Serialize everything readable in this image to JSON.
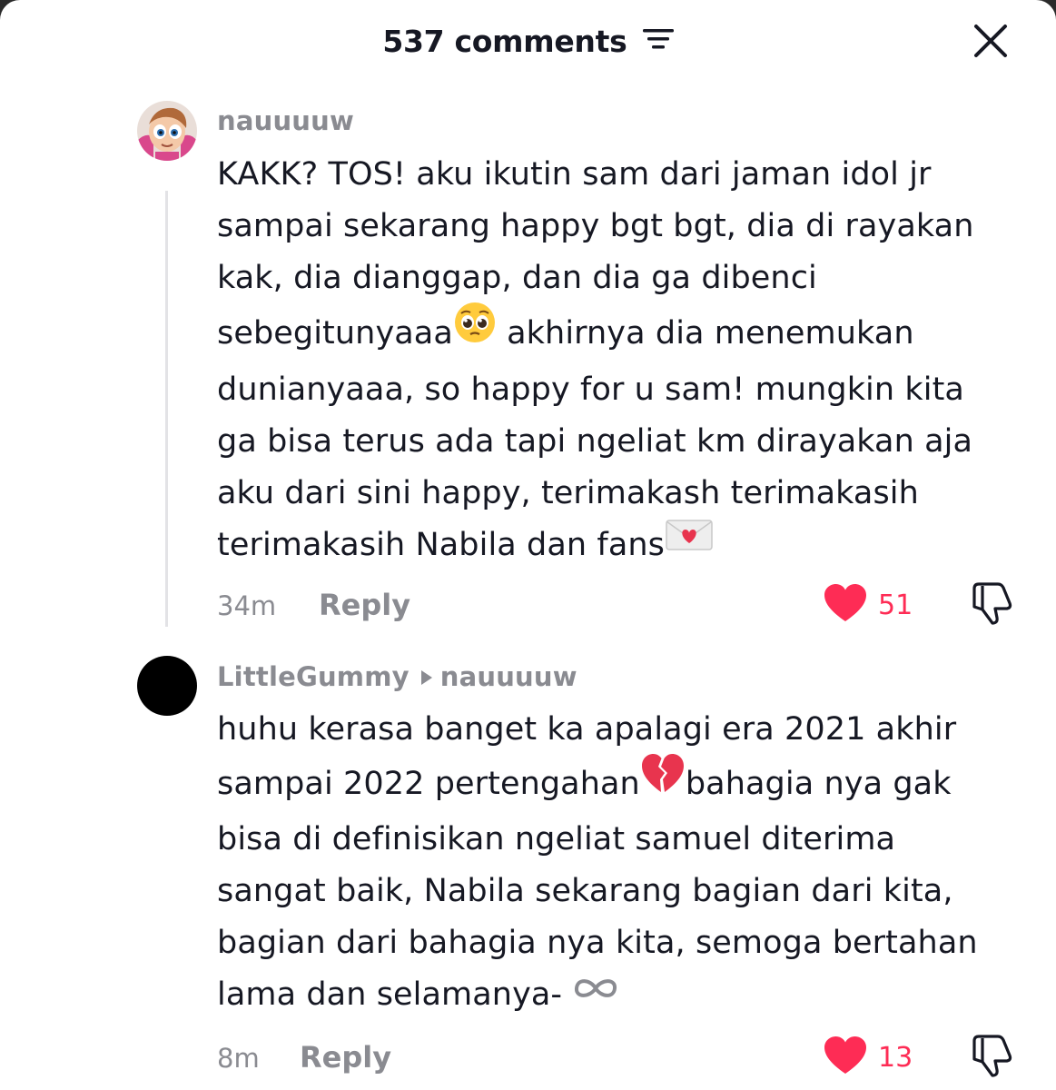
{
  "header": {
    "title": "537 comments",
    "sort_icon": "sort-lines-icon",
    "close_icon": "close-icon"
  },
  "colors": {
    "like": "#fe2c55",
    "muted": "#8a8b91",
    "text": "#161823",
    "thread_line": "#e3e3e6"
  },
  "comments": [
    {
      "username": "nauuuuw",
      "avatar_icon": "cartoon-girl-avatar",
      "lines": [
        "KAKK? TOS! aku ikutin sam dari jaman idol jr",
        "sampai sekarang happy bgt bgt, dia di rayakan",
        "kak, dia dianggap, dan dia ga dibenci",
        "sebegitunyaaa",
        " akhirnya dia menemukan",
        "dunianyaaa, so happy for u sam! mungkin kita",
        "ga bisa terus ada tapi ngeliat km dirayakan aja",
        "aku dari sini happy, terimakash terimakasih",
        "terimakasih Nabila dan fans"
      ],
      "emoji_1": "pleading-face-emoji",
      "emoji_2": "love-letter-emoji",
      "time": "34m",
      "reply_label": "Reply",
      "likes": "51"
    },
    {
      "username": "LittleGummy",
      "reply_to": "nauuuuw",
      "avatar_icon": "black-circle-avatar",
      "lines": [
        "huhu kerasa banget ka apalagi era 2021 akhir",
        "sampai 2022 pertengahan",
        "bahagia nya gak",
        "bisa di definisikan ngeliat samuel diterima",
        "sangat baik, Nabila sekarang bagian dari kita,",
        "bagian dari bahagia nya kita, semoga bertahan",
        "lama dan selamanya- "
      ],
      "emoji_1": "broken-heart-emoji",
      "emoji_2": "infinity-icon",
      "time": "8m",
      "reply_label": "Reply",
      "likes": "13"
    }
  ]
}
